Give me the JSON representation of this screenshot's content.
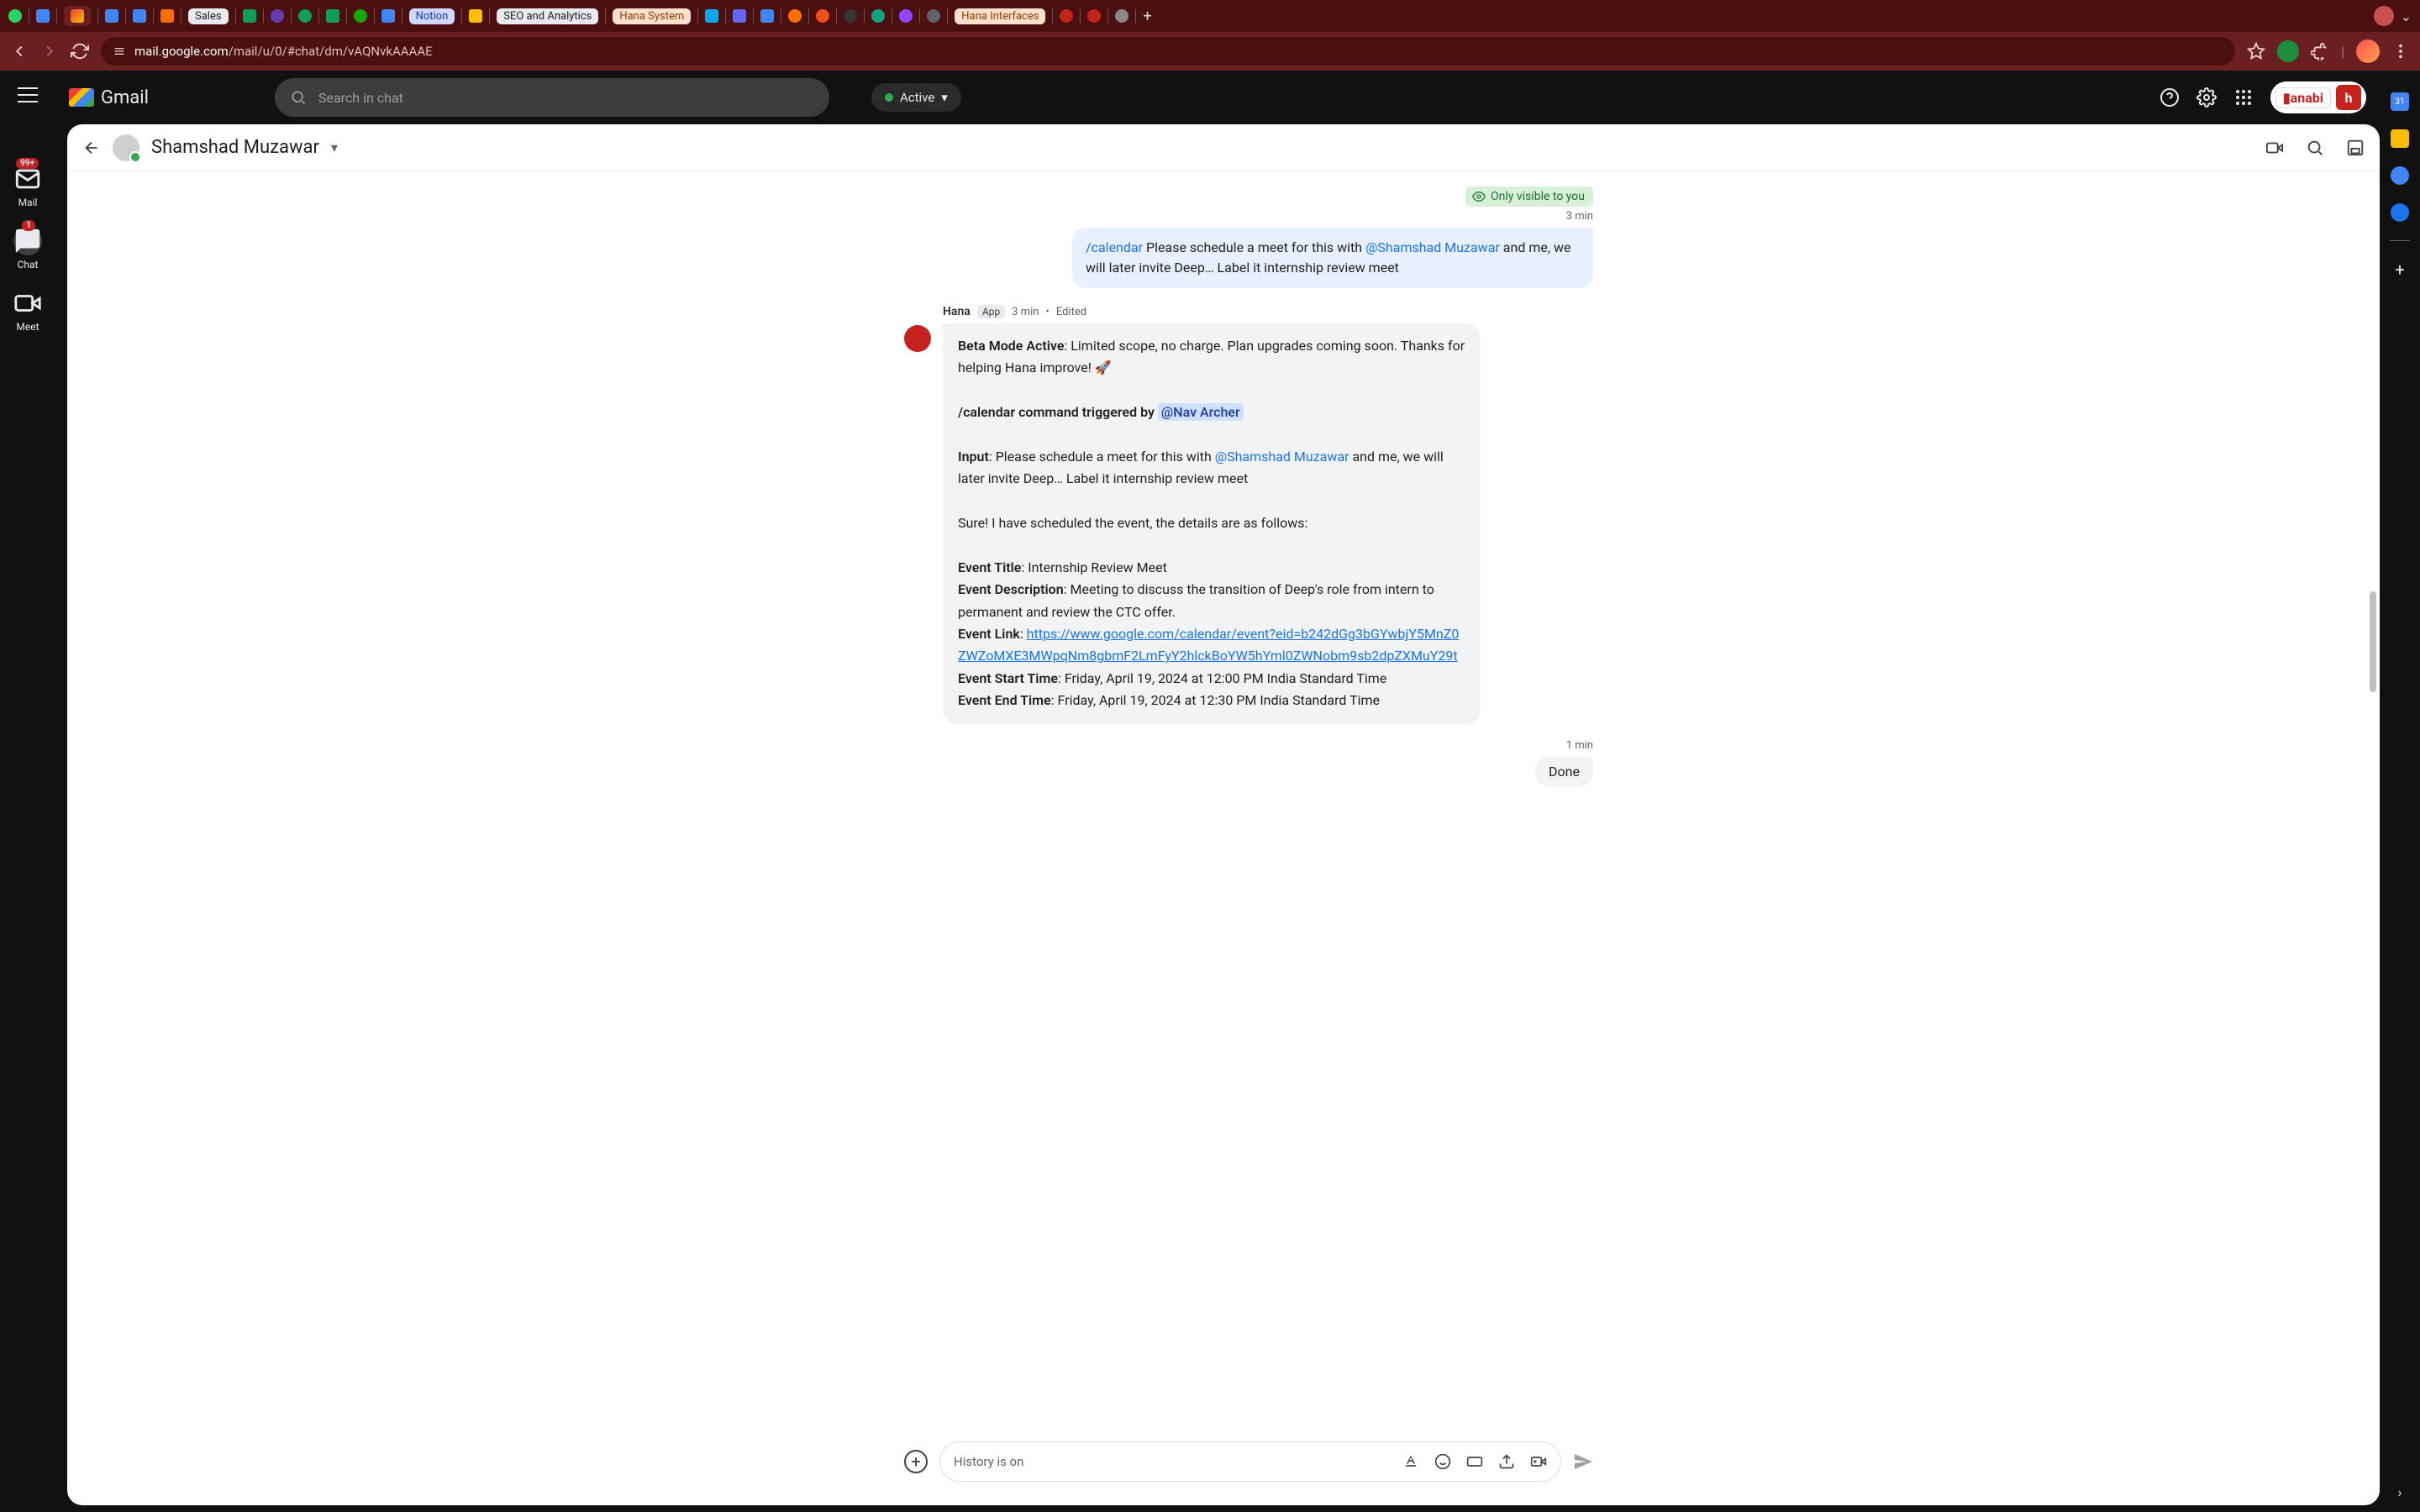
{
  "browser": {
    "tabs": {
      "sales": "Sales",
      "notion": "Notion",
      "seo": "SEO and Analytics",
      "hana_sys": "Hana System",
      "hana_int": "Hana Interfaces"
    },
    "url_host": "mail.google.com",
    "url_path": "/mail/u/0/#chat/dm/vAQNvkAAAAE"
  },
  "gmail": {
    "product": "Gmail",
    "search_placeholder": "Search in chat",
    "status": "Active",
    "hanabi": "anabi"
  },
  "rail": {
    "mail": "Mail",
    "mail_badge": "99+",
    "chat": "Chat",
    "chat_badge": "1",
    "meet": "Meet"
  },
  "chat": {
    "dm_name": "Shamshad Muzawar",
    "visibility": "Only visible to you",
    "out_ts": "3 min",
    "out_cmd": "/calendar",
    "out_text_1": " Please schedule a meet for this with ",
    "out_mention": "@Shamshad Muzawar",
    "out_text_2": " and me, we will later invite Deep… Label it internship review meet",
    "hana": {
      "name": "Hana",
      "app": "App",
      "ts": "3 min",
      "edited": "Edited",
      "beta_label": "Beta Mode Active",
      "beta_text": ": Limited scope, no charge. Plan upgrades coming soon. Thanks for helping Hana improve! 🚀",
      "trigger_label": "/calendar command triggered by",
      "trigger_user": "@Nav Archer",
      "input_label": "Input",
      "input_text": ": Please schedule a meet for this with ",
      "input_mention": "@Shamshad Muzawar",
      "input_tail": " and me, we will later invite Deep… Label it internship review meet",
      "confirm": "Sure! I have scheduled the event, the details are as follows:",
      "ev_title_l": "Event Title",
      "ev_title_v": ": Internship Review Meet",
      "ev_desc_l": "Event Description",
      "ev_desc_v": ": Meeting to discuss the transition of Deep's role from intern to permanent and review the CTC offer.",
      "ev_link_l": "Event Link",
      "ev_link_v": "https://www.google.com/calendar/event?eid=b242dGg3bGYwbjY5MnZ0ZWZoMXE3MWpqNm8gbmF2LmFyY2hlckBoYW5hYml0ZWNobm9sb2dpZXMuY29t",
      "ev_start_l": "Event Start Time",
      "ev_start_v": ": Friday, April 19, 2024 at 12:00 PM India Standard Time",
      "ev_end_l": "Event End Time",
      "ev_end_v": ": Friday, April 19, 2024 at 12:30 PM India Standard Time"
    },
    "done_ts": "1 min",
    "done_text": "Done"
  },
  "composer": {
    "placeholder": "History is on"
  },
  "side_panel": {
    "cal_day": "31"
  }
}
